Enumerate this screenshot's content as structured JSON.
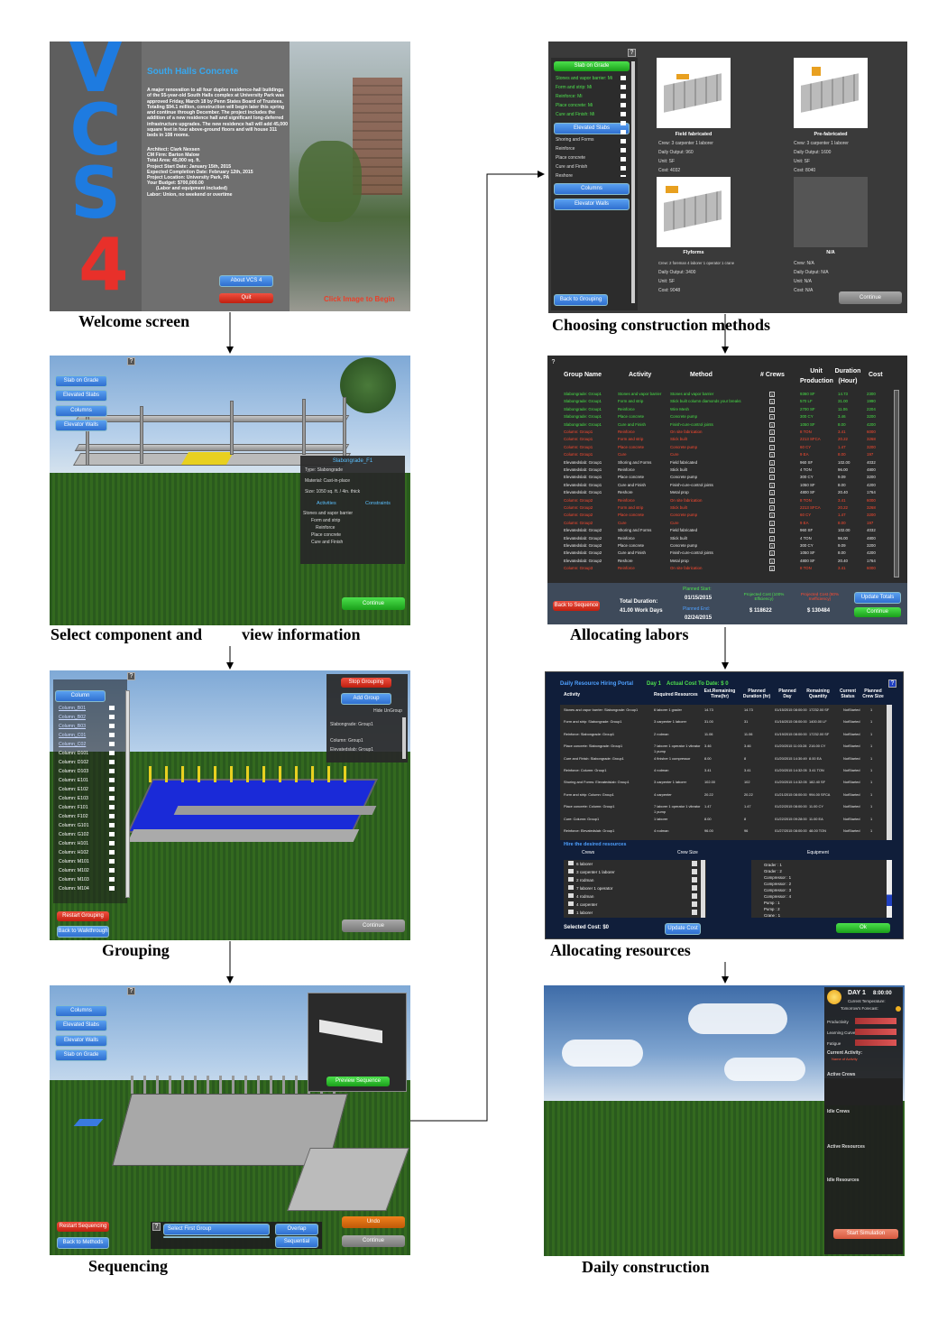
{
  "captions": {
    "welcome": "Welcome screen",
    "select": "Select component and",
    "select2": "view information",
    "grouping": "Grouping",
    "sequencing": "Sequencing",
    "methods": "Choosing construction methods",
    "labors": "Allocating labors",
    "resources": "Allocating resources",
    "daily": "Daily construction"
  },
  "welcome": {
    "logo": "VCS",
    "logo_num": "4",
    "title": "South Halls Concrete",
    "body": "A major renovation to all four duplex residence-hall buildings of the 55-year-old South Halls complex at University Park was approved Friday, March 18 by Penn States Board of Trustees. Totaling $94.1 million, construction will begin later this spring and continue through December. The project includes the addition of a new residence hall and significant long-deferred infrastructure upgrades. The new residence hall will add 45,000 square feet in four above-ground floors and will house 311 beds in 108 rooms.",
    "details": [
      "Architect: Clark Nexsen",
      "CM Firm: Barton Malow",
      "Total Area: 45,000 sq. ft.",
      "Project Start Date: January 15th, 2015",
      "Expected Completion Date: February 12th, 2015",
      "Project Location: University Park, PA",
      "Your Budget: $700,000.00",
      "(Labor and equipment included)",
      "Labor: Union, no weekend or overtime"
    ],
    "about": "About VCS 4",
    "quit": "Quit",
    "click": "Click Image to Begin"
  },
  "select": {
    "buttons": [
      "Slab on Grade",
      "Elevated Slabs",
      "Columns",
      "Elevator Walls"
    ],
    "info_title": "Slabongrade_F1",
    "info": [
      "Type: Slabongrade",
      "Material: Cast-in-place",
      "Size: 1050 sq. ft. / 4in. thick"
    ],
    "act_hdr": "Activities",
    "con_hdr": "Constraints",
    "activities": [
      "Stones and vapor barrier",
      "Form and strip",
      "Reinforce",
      "Place concrete",
      "Cure and Finish"
    ],
    "continue": "Continue"
  },
  "grouping": {
    "column": "Column",
    "items": [
      "Column_B01",
      "Column_B02",
      "Column_B03",
      "Column_C01",
      "Column_C02",
      "Column: D101",
      "Column: D102",
      "Column: D103",
      "Column: E101",
      "Column: E102",
      "Column: E103",
      "Column: F101",
      "Column: F102",
      "Column: G101",
      "Column: G102",
      "Column: H101",
      "Column: H102",
      "Column: M101",
      "Column: M102",
      "Column: M103"
    ],
    "stop": "Stop Grouping",
    "add": "Add Group",
    "hide": "Hide UnGroup",
    "groups": [
      "Slabongrade: Group1",
      "Column: Group1",
      "Elevatedslab: Group1"
    ],
    "restart": "Restart Grouping",
    "back": "Back to Walkthrough",
    "continue": "Continue"
  },
  "sequencing": {
    "buttons": [
      "Columns",
      "Elevated Slabs",
      "Elevator Walls",
      "Slab on Grade"
    ],
    "preview": "Preview Sequence",
    "select_first": "Select First Group",
    "overlap": "Overlap",
    "sequential": "Sequential",
    "undo": "Undo",
    "continue": "Continue",
    "restart": "Restart Sequencing",
    "back": "Back to Methods"
  },
  "methods": {
    "left_header": "Slab on Grade",
    "subitems": [
      "Stones and vapor barrier: Mi",
      "Form and strip: Mi",
      "Reinforce: Mi",
      "Place concrete: Mi",
      "Cure and Finish: Mi"
    ],
    "elevated": "Elevated Slabs",
    "activities": [
      "Shoring and Forms",
      "Reinforce",
      "Place concrete",
      "Cure and Finish",
      "Reshore"
    ],
    "columns": "Columns",
    "elevator": "Elevator Walls",
    "back": "Back to Grouping",
    "continue": "Continue",
    "cards": [
      {
        "name": "Field fabricated",
        "lines": [
          "Crew: 3 carpenter 1 laborer",
          "Daily Output: 960",
          "Unit: SF",
          "Cost: 4032"
        ]
      },
      {
        "name": "Pre-fabricated",
        "lines": [
          "Crew: 3 carpenter 1 laborer",
          "Daily Output: 1600",
          "Unit: SF",
          "Cost: 8040"
        ]
      },
      {
        "name": "Flyforms",
        "lines": [
          "Crew: 2 foreman 4 laborer 1 operator 1 crane",
          "Daily Output: 3400",
          "Unit: SF",
          "Cost: 9048"
        ]
      },
      {
        "name": "N/A",
        "lines": [
          "Crew: N/A",
          "Daily Output: N/A",
          "Unit: N/A",
          "Cost: N/A"
        ]
      }
    ]
  },
  "labors": {
    "headers": [
      "Group Name",
      "Activity",
      "Method",
      "# Crews",
      "Unit Production",
      "Duration (Hour)",
      "Cost"
    ],
    "rows": [
      [
        "Slabongrade: Group1",
        "Stones and vapor barrier",
        "Stones and vapor barrier",
        "1",
        "9360 SF",
        "14.73",
        "2300",
        "g"
      ],
      [
        "Slabongrade: Group1",
        "Form and strip",
        "Stick built column diamonds your breaks",
        "1",
        "570 LF",
        "31.00",
        "1990",
        "g"
      ],
      [
        "Slabongrade: Group1",
        "Reinforce",
        "Wire Mesh",
        "1",
        "2700 SF",
        "11.06",
        "2204",
        "g"
      ],
      [
        "Slabongrade: Group1",
        "Place concrete",
        "Concrete pump",
        "1",
        "300 CY",
        "3.46",
        "3200",
        "g"
      ],
      [
        "Slabongrade: Group1",
        "Cure and Finish",
        "Finish-cure-control joints",
        "1",
        "1050 SF",
        "8.00",
        "4200",
        "g"
      ],
      [
        "Column: Group1",
        "Reinforce",
        "On site fabrication",
        "1",
        "8 TON",
        "3.41",
        "6000",
        "r"
      ],
      [
        "Column: Group1",
        "Form and strip",
        "Stick built",
        "1",
        "2213 SFCA",
        "20.22",
        "3268",
        "r"
      ],
      [
        "Column: Group1",
        "Place concrete",
        "Concrete pump",
        "1",
        "60 CY",
        "1.47",
        "3200",
        "r"
      ],
      [
        "Column: Group1",
        "Cure",
        "Cure",
        "1",
        "9 EA",
        "8.00",
        "197",
        "r"
      ],
      [
        "Elevatedslab: Group1",
        "Shoring and Forms",
        "Field fabricated",
        "1",
        "960 SF",
        "102.00",
        "4032",
        "w"
      ],
      [
        "Elevatedslab: Group1",
        "Reinforce",
        "Stick built",
        "1",
        "4 TON",
        "96.00",
        "4800",
        "w"
      ],
      [
        "Elevatedslab: Group1",
        "Place concrete",
        "Concrete pump",
        "1",
        "300 CY",
        "9.09",
        "3200",
        "w"
      ],
      [
        "Elevatedslab: Group1",
        "Cure and Finish",
        "Finish-cure-control joints",
        "1",
        "1050 SF",
        "8.00",
        "4200",
        "w"
      ],
      [
        "Elevatedslab: Group1",
        "Reshore",
        "Metal prop",
        "1",
        "4800 SF",
        "20.40",
        "1764",
        "w"
      ],
      [
        "Column: Group2",
        "Reinforce",
        "On site fabrication",
        "1",
        "8 TON",
        "3.41",
        "6000",
        "r"
      ],
      [
        "Column: Group2",
        "Form and strip",
        "Stick built",
        "1",
        "2213 SFCA",
        "20.22",
        "3268",
        "r"
      ],
      [
        "Column: Group2",
        "Place concrete",
        "Concrete pump",
        "1",
        "60 CY",
        "1.47",
        "3200",
        "r"
      ],
      [
        "Column: Group2",
        "Cure",
        "Cure",
        "1",
        "9 EA",
        "8.00",
        "197",
        "r"
      ],
      [
        "Elevatedslab: Group2",
        "Shoring and Forms",
        "Field fabricated",
        "1",
        "960 SF",
        "102.00",
        "4032",
        "w"
      ],
      [
        "Elevatedslab: Group2",
        "Reinforce",
        "Stick built",
        "1",
        "4 TON",
        "96.00",
        "4800",
        "w"
      ],
      [
        "Elevatedslab: Group2",
        "Place concrete",
        "Concrete pump",
        "1",
        "300 CY",
        "9.09",
        "3200",
        "w"
      ],
      [
        "Elevatedslab: Group2",
        "Cure and Finish",
        "Finish-cure-control joints",
        "1",
        "1050 SF",
        "8.00",
        "4200",
        "w"
      ],
      [
        "Elevatedslab: Group2",
        "Reshore",
        "Metal prop",
        "1",
        "4800 SF",
        "20.40",
        "1764",
        "w"
      ],
      [
        "Column: Group3",
        "Reinforce",
        "On site fabrication",
        "1",
        "8 TON",
        "3.41",
        "6000",
        "r"
      ]
    ],
    "back": "Back to Sequence",
    "total_lbl": "Total Duration:",
    "total": "41.00 Work Days",
    "start_lbl": "Planned Start:",
    "start": "01/15/2015",
    "end_lbl": "Planned End:",
    "end": "02/24/2015",
    "proj_cost_lbl": "Projected Cost (100% Efficiency)",
    "proj_cost": "$ 118622",
    "proj_cost2_lbl": "Projected Cost (80% Inefficiency)",
    "proj_cost2": "$ 130484",
    "update": "Update Totals",
    "continue": "Continue"
  },
  "resources": {
    "title": "Daily Resource Hiring Portal",
    "day": "Day 1",
    "actual": "Actual Cost To Date: $ 0",
    "headers": [
      "Activity",
      "Required Resources",
      "Est.Remaining Time(hr)",
      "Planned Duration (hr)",
      "Planned Day",
      "Remaining Quantity",
      "Current Status",
      "Planned Crew Size"
    ],
    "rows": [
      [
        "Stones and vapor barrier: Slabongrade: Group1",
        "6 laborer 1 grader",
        "14.73",
        "14.73",
        "01/15/2015 08:00:00",
        "17232.00 SF",
        "NotStarted",
        "1"
      ],
      [
        "Form and strip: Slabongrade: Group1",
        "3 carpenter 1 laborer",
        "31.00",
        "31",
        "01/16/2015 08:00:00",
        "1400.00 LF",
        "NotStarted",
        "1"
      ],
      [
        "Reinforce: Slabongrade: Group1",
        "2 rodman",
        "11.06",
        "11.06",
        "01/19/2015 08:00:00",
        "17232.00 SF",
        "NotStarted",
        "1"
      ],
      [
        "Place concrete: Slabongrade: Group1",
        "7 laborer 1 operator 1 vibrator 1 pump",
        "3.46",
        "3.46",
        "01/20/2015 11:03:28",
        "216.00 CY",
        "NotStarted",
        "1"
      ],
      [
        "Cure and Finish: Slabongrade: Group1",
        "4 finisher 1 compressor",
        "8.00",
        "8",
        "01/20/2015 14:30:49",
        "8.00 EA",
        "NotStarted",
        "1"
      ],
      [
        "Reinforce: Column: Group1",
        "4 rodman",
        "3.41",
        "3.41",
        "01/20/2015 14:32:05",
        "3.41 TON",
        "NotStarted",
        "1"
      ],
      [
        "Shoring and Forms: Elevatedslab: Group1",
        "3 carpenter 1 laborer",
        "102.00",
        "102",
        "01/20/2015 14:32:05",
        "182.40 SF",
        "NotStarted",
        "1"
      ],
      [
        "Form and strip: Column: Group1",
        "4 carpenter",
        "20.22",
        "20.22",
        "01/21/2015 08:00:00",
        "994.00 SFCA",
        "NotStarted",
        "1"
      ],
      [
        "Place concrete: Column: Group1",
        "7 laborer 1 operator 1 vibrator 1 pump",
        "1.47",
        "1.47",
        "01/22/2015 08:00:00",
        "11.00 CY",
        "NotStarted",
        "1"
      ],
      [
        "Cure: Column: Group1",
        "1 laborer",
        "8.00",
        "8",
        "01/22/2015 09:28:00",
        "11.00 EA",
        "NotStarted",
        "1"
      ],
      [
        "Reinforce: Elevatedslab: Group1",
        "4 rodman",
        "96.00",
        "96",
        "01/27/2015 08:00:00",
        "48.00 TON",
        "NotStarted",
        "1"
      ]
    ],
    "hire": "Hire the desired resources",
    "crews_hdr": "Crews",
    "crewsize_hdr": "Crew Size",
    "equip_hdr": "Equipment",
    "crews": [
      "6 laborer",
      "3 carpenter 1 laborer",
      "2 rodman",
      "7 laborer 1 operator",
      "4 rodman",
      "4 carpenter",
      "1 laborer"
    ],
    "equipment": [
      "Grader : 1",
      "Grader : 2",
      "Compressor : 1",
      "Compressor : 2",
      "Compressor : 3",
      "Compressor : 4",
      "Pump : 1",
      "Pump : 2",
      "Crane : 1"
    ],
    "selected": "Selected Cost: $0",
    "update": "Update Cost",
    "ok": "Ok"
  },
  "daily": {
    "day": "DAY 1",
    "time": "8:00:00",
    "temp": "Current Temperature:",
    "forecast": "Tomorrow's Forecast:",
    "metrics": [
      "Productivity",
      "Learning Curve",
      "Fatigue"
    ],
    "current": "Current Activity:",
    "current_val": "Name of Activity",
    "sections": [
      "Active Crews",
      "Idle Crews",
      "Active Resources",
      "Idle Resources"
    ],
    "start": "Start Simulation"
  },
  "colors": {
    "blue_btn": "#3f86e0",
    "red_btn": "#e03a2a",
    "green_btn": "#2ec52e",
    "vcs_blue": "#1e7be0",
    "vcs_red": "#e8302a"
  }
}
